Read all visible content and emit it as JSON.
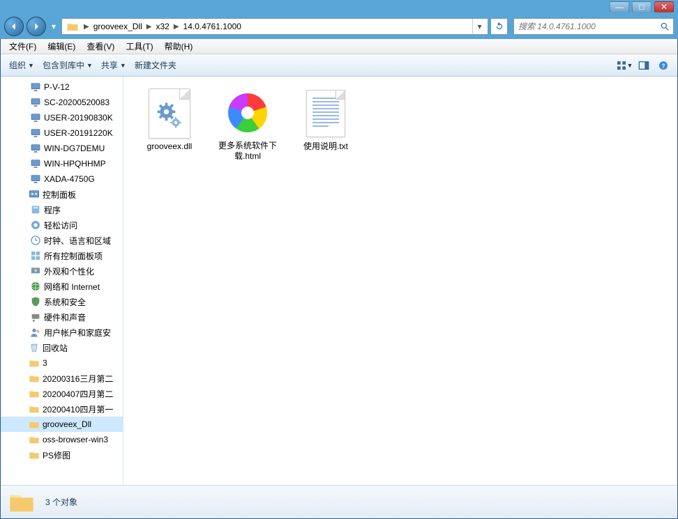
{
  "titlebar": {
    "min": "—",
    "max": "□",
    "close": "✕"
  },
  "nav": {
    "crumbs": [
      "grooveex_Dll",
      "x32",
      "14.0.4761.1000"
    ],
    "search_placeholder": "搜索 14.0.4761.1000"
  },
  "menu": {
    "file": "文件(F)",
    "edit": "编辑(E)",
    "view": "查看(V)",
    "tools": "工具(T)",
    "help": "帮助(H)"
  },
  "cmd": {
    "organize": "组织",
    "include": "包含到库中",
    "share": "共享",
    "newfolder": "新建文件夹"
  },
  "sidebar": {
    "computers": [
      "P-V-12",
      "SC-20200520083",
      "USER-20190830K",
      "USER-20191220K",
      "WIN-DG7DEMU",
      "WIN-HPQHHMP",
      "XADA-4750G"
    ],
    "cp": "控制面板",
    "cp_items": [
      "程序",
      "轻松访问",
      "时钟、语言和区域",
      "所有控制面板项",
      "外观和个性化",
      "网络和 Internet",
      "系统和安全",
      "硬件和声音",
      "用户帐户和家庭安"
    ],
    "recycle": "回收站",
    "folders": [
      "3",
      "20200316三月第二",
      "20200407四月第二",
      "20200410四月第一",
      "grooveex_Dll",
      "oss-browser-win3",
      "PS修图"
    ],
    "selected_index": 4
  },
  "files": [
    {
      "name": "grooveex.dll",
      "type": "dll"
    },
    {
      "name": "更多系统软件下载.html",
      "type": "html"
    },
    {
      "name": "使用说明.txt",
      "type": "txt"
    }
  ],
  "status": {
    "text": "3 个对象"
  }
}
